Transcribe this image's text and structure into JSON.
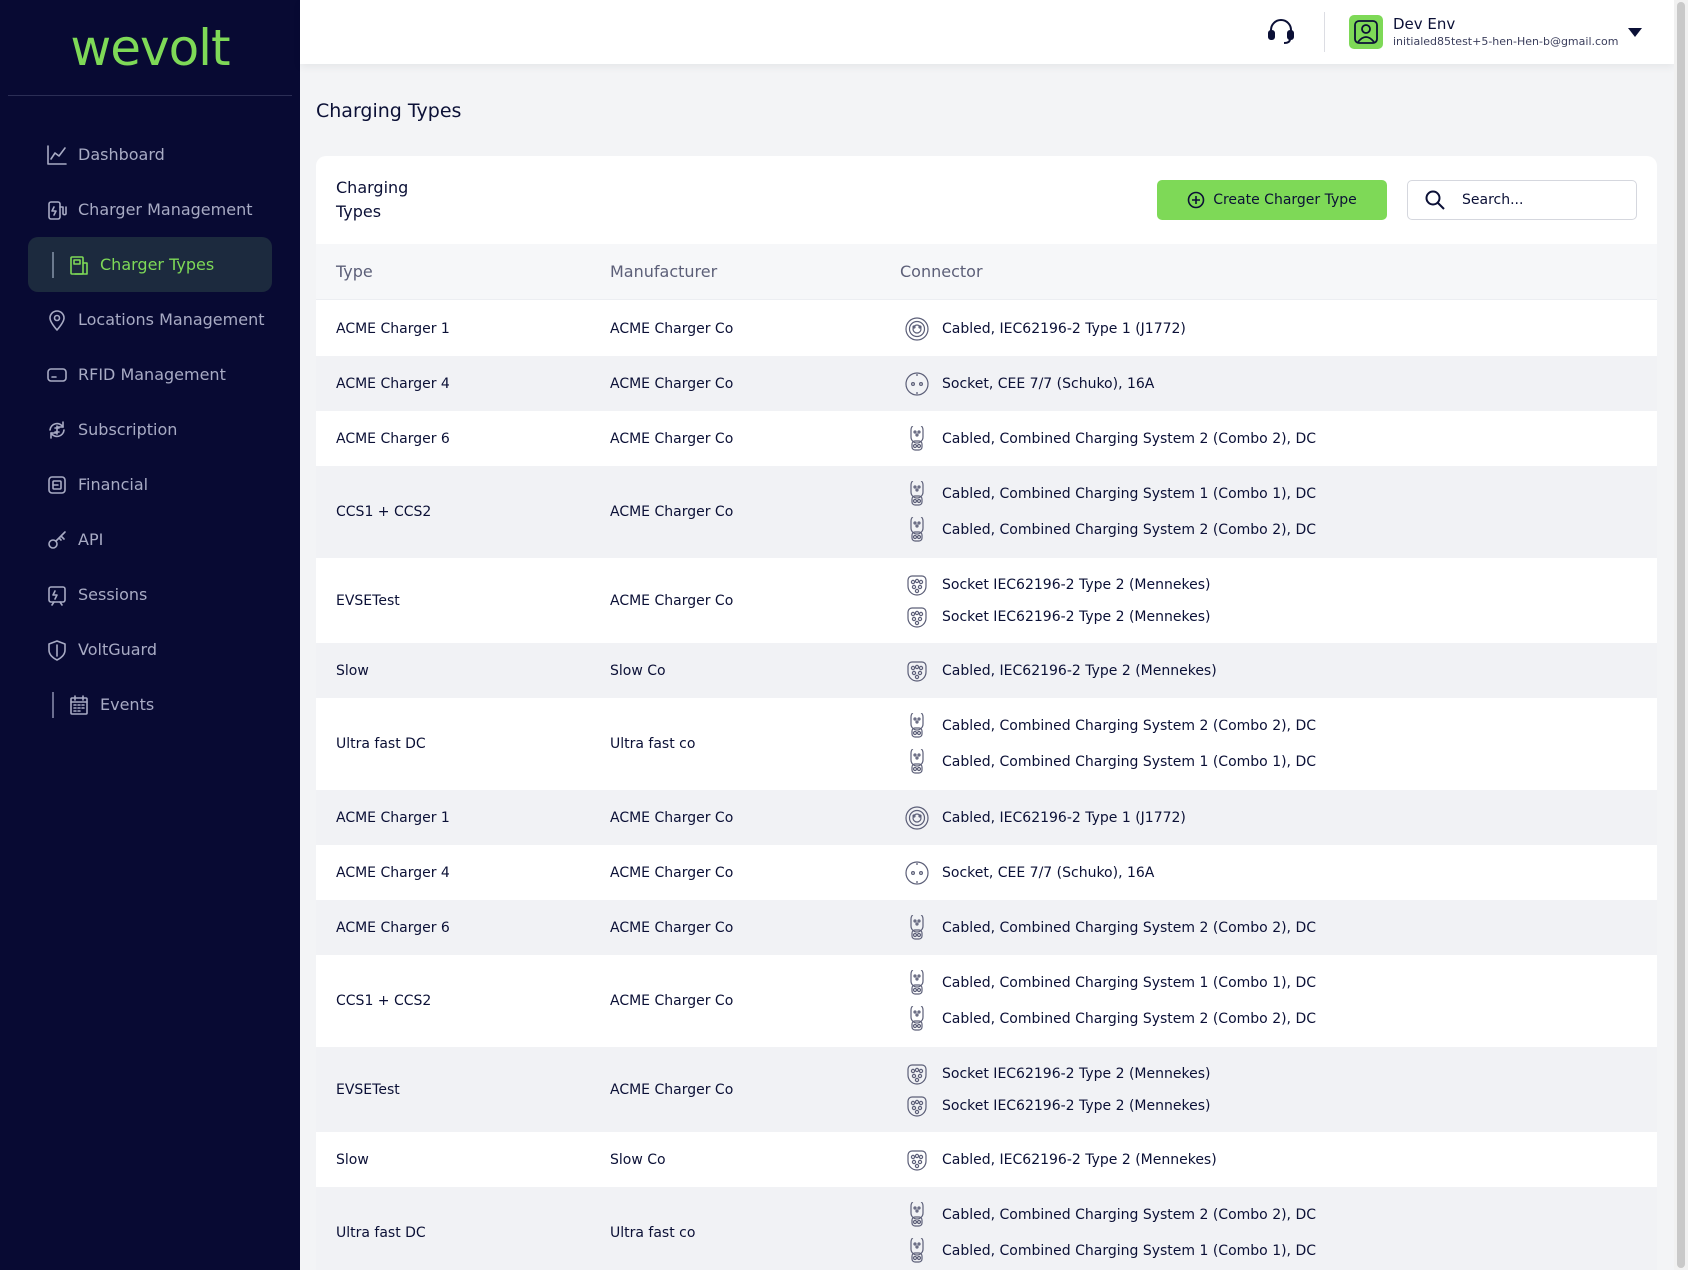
{
  "app": {
    "logo": "wevolt",
    "brand_color": "#7ed957",
    "sidebar_color": "#080a33"
  },
  "sidebar": {
    "items": [
      {
        "label": "Dashboard",
        "icon": "chart-line-icon"
      },
      {
        "label": "Charger Management",
        "icon": "charger-icon"
      },
      {
        "label": "Charger Types",
        "icon": "charger-types-icon",
        "active": true
      },
      {
        "label": "Locations Management",
        "icon": "location-pin-icon"
      },
      {
        "label": "RFID Management",
        "icon": "rfid-card-icon"
      },
      {
        "label": "Subscription",
        "icon": "subscription-icon"
      },
      {
        "label": "Financial",
        "icon": "financial-icon"
      },
      {
        "label": "API",
        "icon": "key-icon"
      },
      {
        "label": "Sessions",
        "icon": "sessions-icon"
      },
      {
        "label": "VoltGuard",
        "icon": "shield-icon"
      },
      {
        "label": "Events",
        "icon": "calendar-icon"
      }
    ]
  },
  "header": {
    "user_name": "Dev Env",
    "user_email": "initialed85test+5-hen-Hen-b@gmail.com"
  },
  "page": {
    "title": "Charging Types"
  },
  "card": {
    "title": "Charging Types",
    "create_button": "Create Charger Type",
    "search_placeholder": "Search..."
  },
  "table": {
    "columns": [
      "Type",
      "Manufacturer",
      "Connector"
    ],
    "rows": [
      {
        "type": "ACME Charger 1",
        "manufacturer": "ACME Charger Co",
        "connectors": [
          {
            "icon": "type1-connector-icon",
            "label": "Cabled, IEC62196-2 Type 1 (J1772)"
          }
        ]
      },
      {
        "type": "ACME Charger 4",
        "manufacturer": "ACME Charger Co",
        "connectors": [
          {
            "icon": "schuko-socket-icon",
            "label": "Socket, CEE 7/7 (Schuko), 16A"
          }
        ]
      },
      {
        "type": "ACME Charger 6",
        "manufacturer": "ACME Charger Co",
        "connectors": [
          {
            "icon": "combo-connector-icon",
            "label": "Cabled, Combined Charging System 2 (Combo 2), DC"
          }
        ]
      },
      {
        "type": "CCS1 + CCS2",
        "manufacturer": "ACME Charger Co",
        "connectors": [
          {
            "icon": "combo-connector-icon",
            "label": "Cabled, Combined Charging System 1 (Combo 1), DC"
          },
          {
            "icon": "combo-connector-icon",
            "label": "Cabled, Combined Charging System 2 (Combo 2), DC"
          }
        ]
      },
      {
        "type": "EVSETest",
        "manufacturer": "ACME Charger Co",
        "connectors": [
          {
            "icon": "type2-connector-icon",
            "label": "Socket IEC62196-2 Type 2 (Mennekes)"
          },
          {
            "icon": "type2-connector-icon",
            "label": "Socket IEC62196-2 Type 2 (Mennekes)"
          }
        ]
      },
      {
        "type": "Slow",
        "manufacturer": "Slow Co",
        "connectors": [
          {
            "icon": "type2-connector-icon",
            "label": "Cabled, IEC62196-2 Type 2 (Mennekes)"
          }
        ]
      },
      {
        "type": "Ultra fast DC",
        "manufacturer": "Ultra fast co",
        "connectors": [
          {
            "icon": "combo-connector-icon",
            "label": "Cabled, Combined Charging System 2 (Combo 2), DC"
          },
          {
            "icon": "combo-connector-icon",
            "label": "Cabled, Combined Charging System 1 (Combo 1), DC"
          }
        ]
      },
      {
        "type": "ACME Charger 1",
        "manufacturer": "ACME Charger Co",
        "connectors": [
          {
            "icon": "type1-connector-icon",
            "label": "Cabled, IEC62196-2 Type 1 (J1772)"
          }
        ]
      },
      {
        "type": "ACME Charger 4",
        "manufacturer": "ACME Charger Co",
        "connectors": [
          {
            "icon": "schuko-socket-icon",
            "label": "Socket, CEE 7/7 (Schuko), 16A"
          }
        ]
      },
      {
        "type": "ACME Charger 6",
        "manufacturer": "ACME Charger Co",
        "connectors": [
          {
            "icon": "combo-connector-icon",
            "label": "Cabled, Combined Charging System 2 (Combo 2), DC"
          }
        ]
      },
      {
        "type": "CCS1 + CCS2",
        "manufacturer": "ACME Charger Co",
        "connectors": [
          {
            "icon": "combo-connector-icon",
            "label": "Cabled, Combined Charging System 1 (Combo 1), DC"
          },
          {
            "icon": "combo-connector-icon",
            "label": "Cabled, Combined Charging System 2 (Combo 2), DC"
          }
        ]
      },
      {
        "type": "EVSETest",
        "manufacturer": "ACME Charger Co",
        "connectors": [
          {
            "icon": "type2-connector-icon",
            "label": "Socket IEC62196-2 Type 2 (Mennekes)"
          },
          {
            "icon": "type2-connector-icon",
            "label": "Socket IEC62196-2 Type 2 (Mennekes)"
          }
        ]
      },
      {
        "type": "Slow",
        "manufacturer": "Slow Co",
        "connectors": [
          {
            "icon": "type2-connector-icon",
            "label": "Cabled, IEC62196-2 Type 2 (Mennekes)"
          }
        ]
      },
      {
        "type": "Ultra fast DC",
        "manufacturer": "Ultra fast co",
        "connectors": [
          {
            "icon": "combo-connector-icon",
            "label": "Cabled, Combined Charging System 2 (Combo 2), DC"
          },
          {
            "icon": "combo-connector-icon",
            "label": "Cabled, Combined Charging System 1 (Combo 1), DC"
          }
        ]
      }
    ]
  }
}
